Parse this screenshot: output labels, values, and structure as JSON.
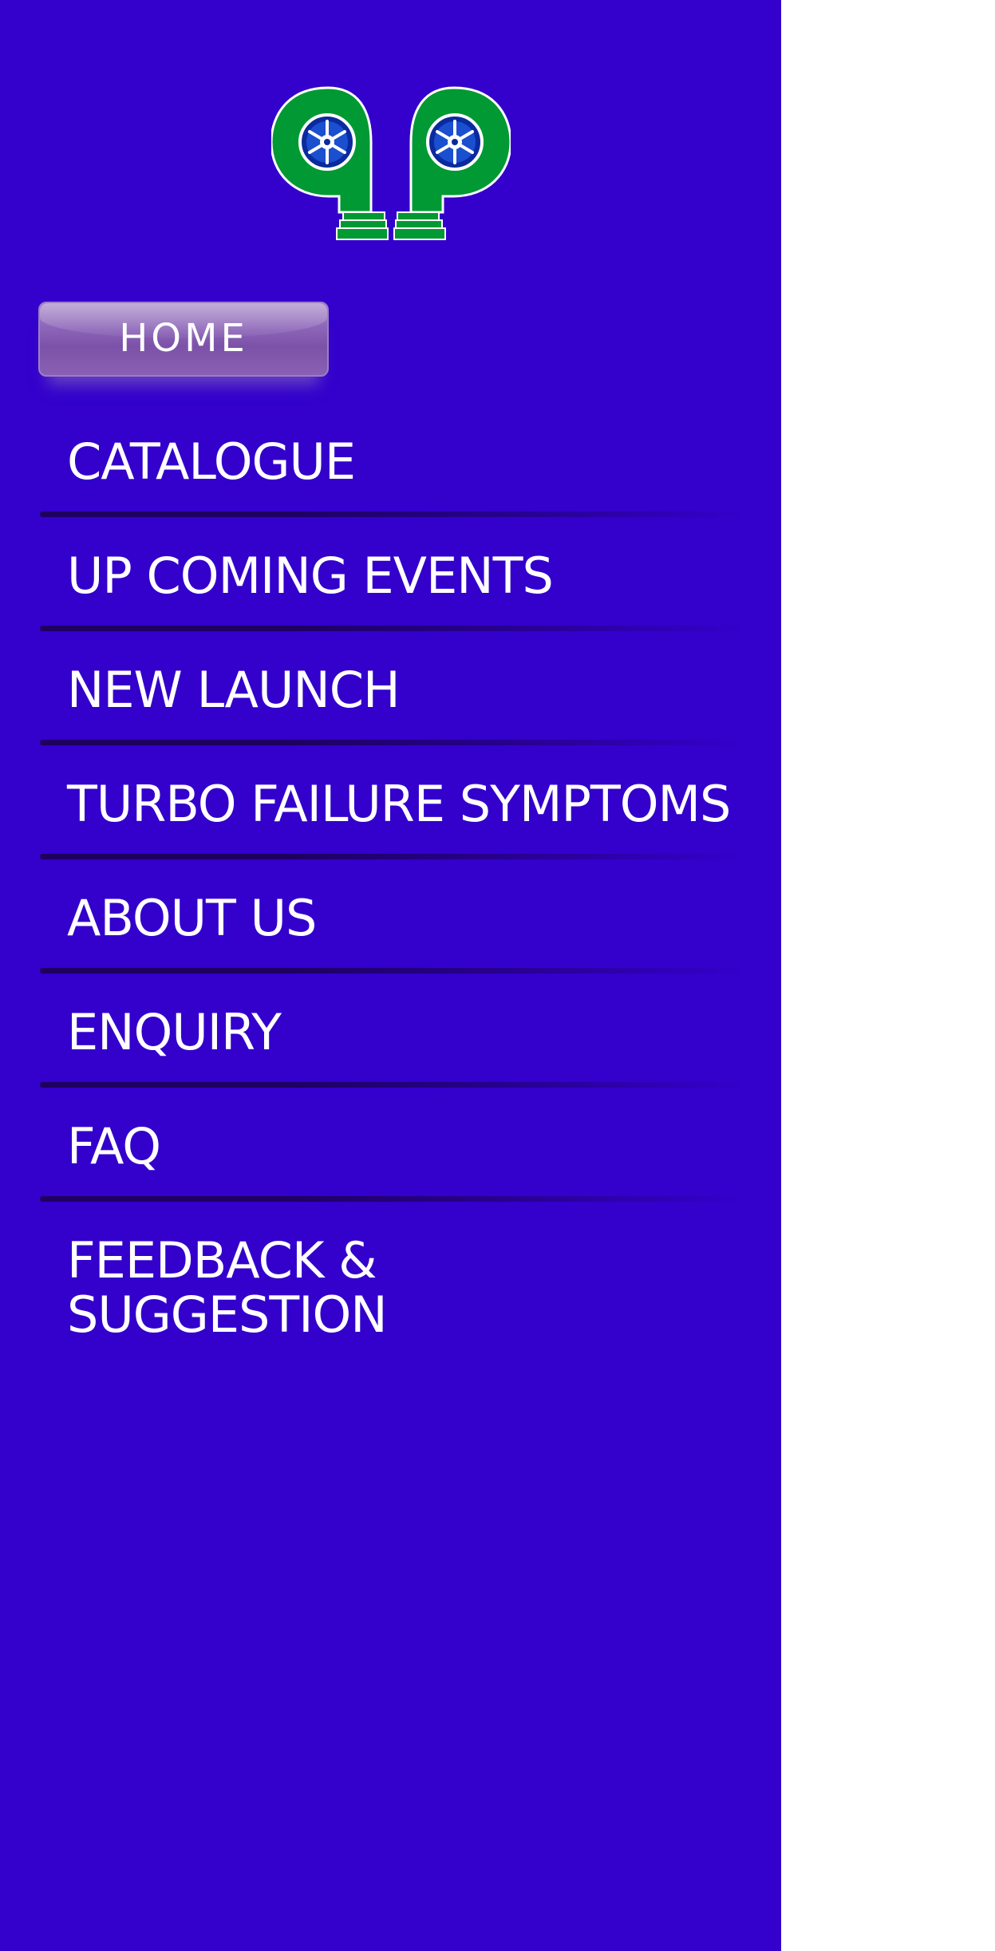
{
  "colors": {
    "drawer_background": "#3300cc",
    "logo_green": "#009933",
    "home_button": "#8c64b8",
    "text": "#ffffff"
  },
  "logo": {
    "icon": "twin-turbo-gp-logo"
  },
  "home_button": {
    "label": "HOME"
  },
  "menu": {
    "items": [
      {
        "label": "CATALOGUE"
      },
      {
        "label": "UP COMING EVENTS"
      },
      {
        "label": "NEW LAUNCH"
      },
      {
        "label": "TURBO FAILURE SYMPTOMS"
      },
      {
        "label": "ABOUT US"
      },
      {
        "label": "ENQUIRY"
      },
      {
        "label": "FAQ"
      },
      {
        "label": "FEEDBACK & SUGGESTION"
      }
    ]
  }
}
